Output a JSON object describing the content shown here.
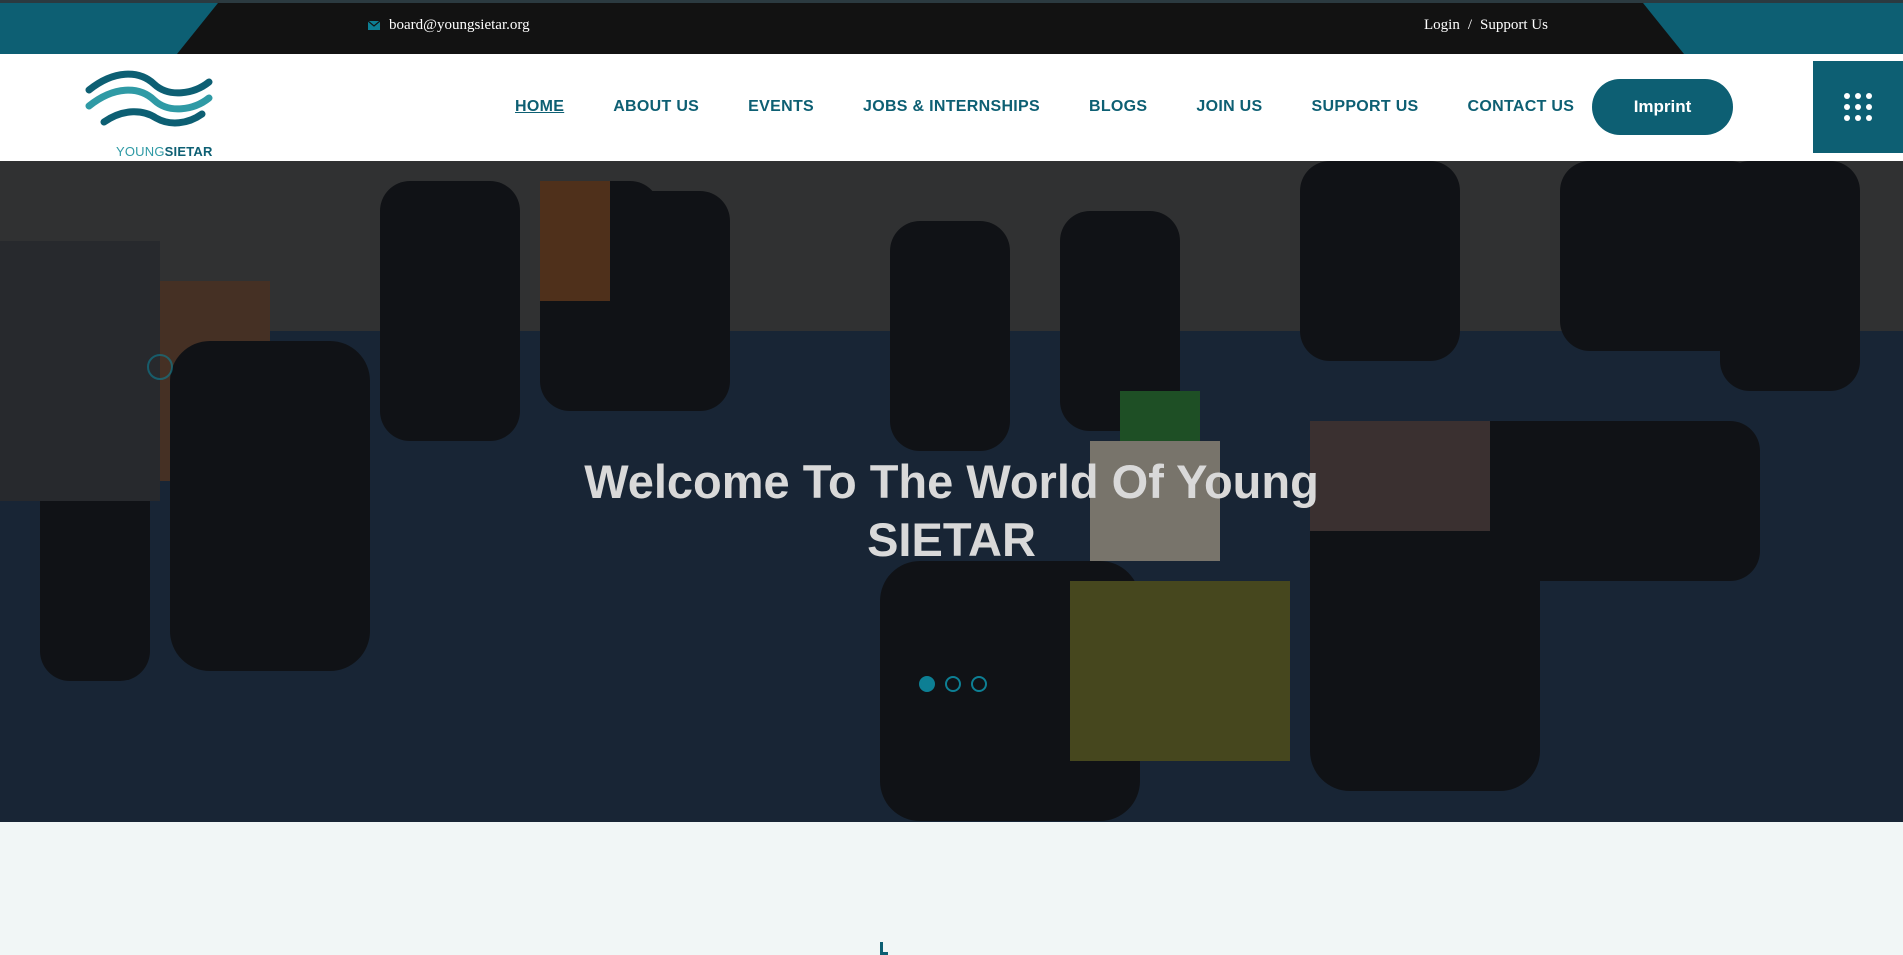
{
  "topbar": {
    "email": "board@youngsietar.org",
    "login_label": "Login",
    "separator": "/",
    "support_label": "Support Us"
  },
  "header": {
    "logo_text_light": "YOUNG",
    "logo_text_bold": "SIETAR",
    "nav": [
      "HOME",
      "ABOUT US",
      "EVENTS",
      "JOBS & INTERNSHIPS",
      "BLOGS",
      "JOIN US",
      "SUPPORT US",
      "CONTACT US"
    ],
    "active_nav": "HOME",
    "imprint_label": "Imprint",
    "menu_icon": "grid-menu-icon"
  },
  "hero": {
    "title_line1": "Welcome To The World Of Young",
    "title_line2": "SIETAR",
    "slides": 3,
    "active_slide": 1
  },
  "colors": {
    "brand": "#0d5f73",
    "accent": "#0d7f94",
    "topbar_dark": "#121212",
    "page_bg": "#f1f6f6"
  }
}
